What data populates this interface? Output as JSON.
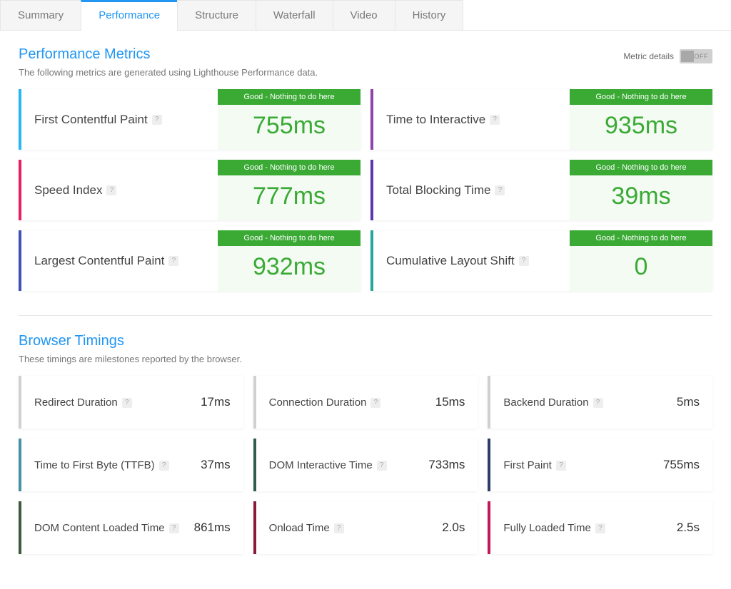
{
  "tabs": {
    "summary": "Summary",
    "performance": "Performance",
    "structure": "Structure",
    "waterfall": "Waterfall",
    "video": "Video",
    "history": "History"
  },
  "perf": {
    "title": "Performance Metrics",
    "subtitle": "The following metrics are generated using Lighthouse Performance data.",
    "goodBadge": "Good - Nothing to do here",
    "toggle": {
      "label": "Metric details",
      "state": "OFF"
    },
    "metrics": [
      {
        "label": "First Contentful Paint",
        "value": "755ms",
        "accent": "#29B6F6"
      },
      {
        "label": "Time to Interactive",
        "value": "935ms",
        "accent": "#8E44AD"
      },
      {
        "label": "Speed Index",
        "value": "777ms",
        "accent": "#E91E63"
      },
      {
        "label": "Total Blocking Time",
        "value": "39ms",
        "accent": "#5E35B1"
      },
      {
        "label": "Largest Contentful Paint",
        "value": "932ms",
        "accent": "#3F51B5"
      },
      {
        "label": "Cumulative Layout Shift",
        "value": "0",
        "accent": "#26A69A"
      }
    ]
  },
  "timings": {
    "title": "Browser Timings",
    "subtitle": "These timings are milestones reported by the browser.",
    "items": [
      {
        "label": "Redirect Duration",
        "value": "17ms",
        "accent": "#D0D0D0"
      },
      {
        "label": "Connection Duration",
        "value": "15ms",
        "accent": "#D0D0D0"
      },
      {
        "label": "Backend Duration",
        "value": "5ms",
        "accent": "#D0D0D0"
      },
      {
        "label": "Time to First Byte (TTFB)",
        "value": "37ms",
        "accent": "#4A90A4"
      },
      {
        "label": "DOM Interactive Time",
        "value": "733ms",
        "accent": "#2E5C4E"
      },
      {
        "label": "First Paint",
        "value": "755ms",
        "accent": "#2C3E66"
      },
      {
        "label": "DOM Content Loaded Time",
        "value": "861ms",
        "accent": "#3D5A3D"
      },
      {
        "label": "Onload Time",
        "value": "2.0s",
        "accent": "#8B1A3A"
      },
      {
        "label": "Fully Loaded Time",
        "value": "2.5s",
        "accent": "#C2185B"
      }
    ]
  },
  "help": "?"
}
